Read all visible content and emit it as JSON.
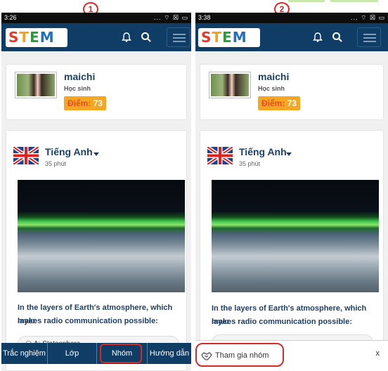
{
  "markers": {
    "first": "1",
    "second": "2"
  },
  "screens": [
    {
      "status": {
        "time": "3:26",
        "icons": "... ⌔ ☒ ▭"
      },
      "brand": {
        "logo": [
          "S",
          "T",
          "E",
          "M"
        ]
      },
      "profile": {
        "name": "maichi",
        "role": "Học sinh",
        "score_label": "Điểm:",
        "score_value": "73"
      },
      "lesson": {
        "language": "Tiếng Anh",
        "duration": "35 phút",
        "question_line1": "In the layers of Earth's atmosphere, which layer",
        "question_line2": "makes radio communication possible:",
        "option_a": "A: Statosphere"
      },
      "bottom_nav": [
        "Trắc nghiệm",
        "Lớp",
        "Nhóm",
        "Hướng dẫn"
      ]
    },
    {
      "status": {
        "time": "3:38",
        "icons": "... ⌔ ☒ ▭"
      },
      "brand": {
        "logo": [
          "S",
          "T",
          "E",
          "M"
        ]
      },
      "profile": {
        "name": "maichi",
        "role": "Học sinh",
        "score_label": "Điểm:",
        "score_value": "73"
      },
      "lesson": {
        "language": "Tiếng Anh",
        "duration": "35 phút",
        "question_line1": "In the layers of Earth's atmosphere, which layer",
        "question_line2": "makes radio communication possible:"
      },
      "toast": {
        "text": "Tham gia nhóm",
        "close": "x"
      }
    }
  ],
  "colors": {
    "header": "#0f3d66",
    "accent_score": "#f5a623",
    "highlight": "#d42a2a",
    "text_primary": "#1e3f66"
  }
}
